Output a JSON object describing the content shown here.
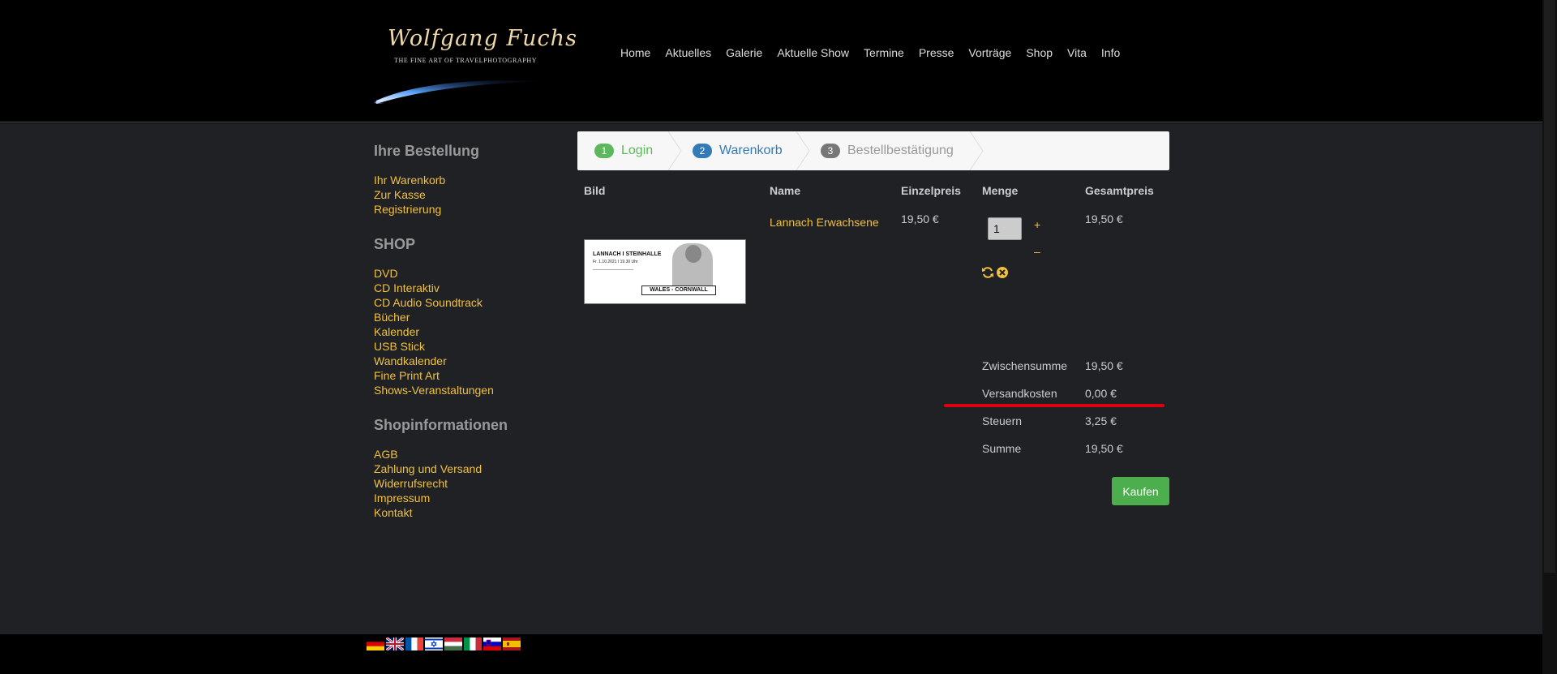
{
  "logo": {
    "title": "Wolfgang Fuchs",
    "subtitle": "THE FINE ART OF TRAVELPHOTOGRAPHY"
  },
  "nav": [
    "Home",
    "Aktuelles",
    "Galerie",
    "Aktuelle Show",
    "Termine",
    "Presse",
    "Vorträge",
    "Shop",
    "Vita",
    "Info"
  ],
  "sidebar": {
    "sections": [
      {
        "title": "Ihre Bestellung",
        "items": [
          "Ihr Warenkorb",
          "Zur Kasse",
          "Registrierung"
        ]
      },
      {
        "title": "SHOP",
        "items": [
          "DVD",
          "CD Interaktiv",
          "CD Audio Soundtrack",
          "Bücher",
          "Kalender",
          "USB Stick",
          "Wandkalender",
          "Fine Print Art",
          "Shows-Veranstaltungen"
        ]
      },
      {
        "title": "Shopinformationen",
        "items": [
          "AGB",
          "Zahlung und Versand",
          "Widerrufsrecht",
          "Impressum",
          "Kontakt"
        ]
      }
    ]
  },
  "steps": [
    {
      "num": "1",
      "label": "Login",
      "color": "#5cb85c"
    },
    {
      "num": "2",
      "label": "Warenkorb",
      "color": "#337ab7"
    },
    {
      "num": "3",
      "label": "Bestellbestätigung",
      "color": "#777777"
    }
  ],
  "cart": {
    "headers": {
      "image": "Bild",
      "name": "Name",
      "unit": "Einzelpreis",
      "qty": "Menge",
      "total": "Gesamtpreis"
    },
    "item": {
      "name": "Lannach Erwachsene",
      "unit_price": "19,50 €",
      "quantity": "1",
      "plus": "+",
      "minus": "–",
      "total": "19,50 €",
      "ticket": {
        "venue": "LANNACH  I  STEINHALLE",
        "date": "Fr. 1.10.2021  I  19.30 Uhr",
        "show": "WALES - CORNWALL"
      }
    },
    "summary": [
      {
        "label": "Zwischensumme",
        "value": "19,50 €"
      },
      {
        "label": "Versandkosten",
        "value": "0,00 €"
      },
      {
        "label": "Steuern",
        "value": "3,25 €"
      },
      {
        "label": "Summe",
        "value": "19,50 €"
      }
    ],
    "buy_label": "Kaufen"
  },
  "flags": [
    "de",
    "gb",
    "fr",
    "il",
    "hu",
    "it",
    "si",
    "es"
  ],
  "colors": {
    "accent": "#f0c040",
    "buy": "#4cae4c",
    "highlight": "#e0000d"
  }
}
